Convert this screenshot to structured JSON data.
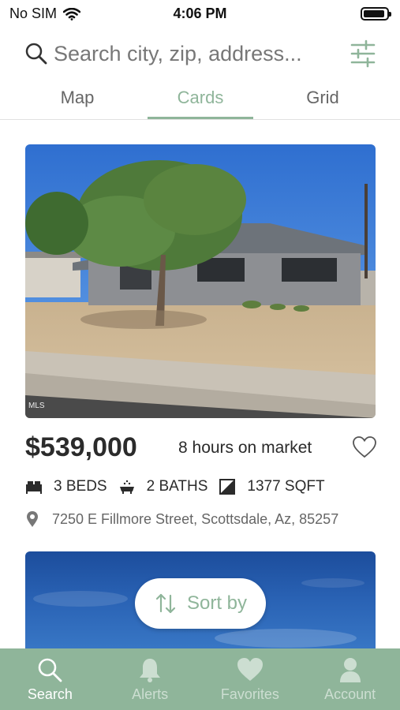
{
  "status": {
    "carrier": "No SIM",
    "time": "4:06 PM"
  },
  "search": {
    "placeholder": "Search city, zip, address..."
  },
  "tabs": [
    {
      "label": "Map",
      "active": false
    },
    {
      "label": "Cards",
      "active": true
    },
    {
      "label": "Grid",
      "active": false
    }
  ],
  "listing": {
    "photo_tag": "MLS",
    "price": "$539,000",
    "market_time": "8 hours on market",
    "beds": "3 BEDS",
    "baths": "2 BATHS",
    "sqft": "1377 SQFT",
    "address": "7250 E Fillmore Street, Scottsdale, Az, 85257"
  },
  "sort": {
    "label": "Sort by"
  },
  "nav": [
    {
      "label": "Search",
      "icon": "search-icon",
      "active": true
    },
    {
      "label": "Alerts",
      "icon": "bell-icon",
      "active": false
    },
    {
      "label": "Favorites",
      "icon": "heart-icon",
      "active": false
    },
    {
      "label": "Account",
      "icon": "person-icon",
      "active": false
    }
  ],
  "colors": {
    "accent": "#8fb59a",
    "text": "#2b2b2b",
    "muted": "#666666"
  }
}
